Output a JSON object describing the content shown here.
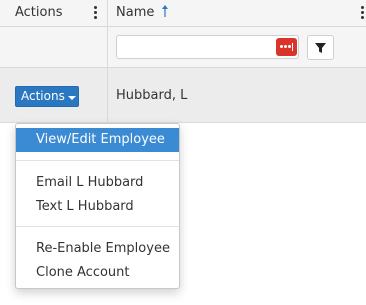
{
  "header": {
    "actions_label": "Actions",
    "name_label": "Name",
    "sort_icon": "sort-ascending-arrow-icon",
    "menu_icon": "kebab-menu-icon"
  },
  "filter": {
    "name_value": "",
    "password_icon": "password-manager-icon",
    "filter_icon": "funnel-icon"
  },
  "row": {
    "actions_button": "Actions",
    "name": "Hubbard, L"
  },
  "menu": {
    "items": [
      {
        "label": "View/Edit Employee"
      },
      {
        "label": "Email L Hubbard"
      },
      {
        "label": "Text L Hubbard"
      },
      {
        "label": "Re-Enable Employee"
      },
      {
        "label": "Clone Account"
      }
    ]
  },
  "colors": {
    "accent": "#2b78c2",
    "menu_highlight": "#3a8ad4",
    "password_icon": "#d9342b",
    "header_bg": "#f5f5f5",
    "row_bg": "#ececec"
  }
}
